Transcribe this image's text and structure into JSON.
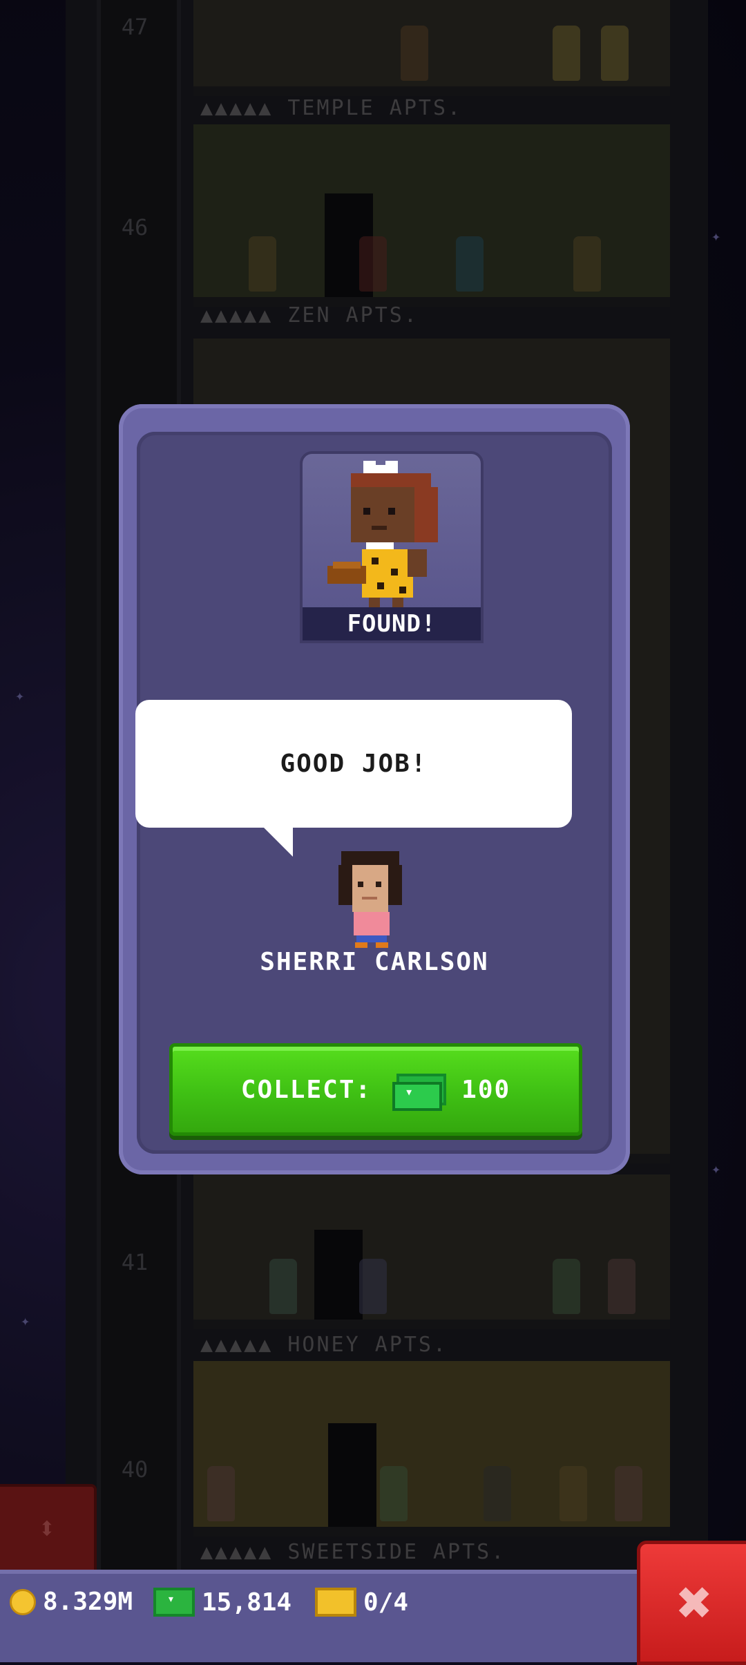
{
  "tower": {
    "floors": [
      {
        "number": "47",
        "name": ""
      },
      {
        "number": "46",
        "name": "TEMPLE APTS."
      },
      {
        "number": "",
        "name": "ZEN APTS."
      },
      {
        "number": "41",
        "name": ""
      },
      {
        "number": "40",
        "name": "HONEY APTS."
      },
      {
        "number": "",
        "name": "SWEETSIDE APTS."
      }
    ]
  },
  "modal": {
    "portrait_label": "FOUND!",
    "speech": "GOOD JOB!",
    "npc_name": "SHERRI CARLSON",
    "collect_label": "COLLECT:",
    "collect_amount": "100"
  },
  "bottom_bar": {
    "coins": "8.329M",
    "bux": "15,814",
    "tickets": "0/4"
  },
  "icons": {
    "coin": "coin-icon",
    "bux": "bux-icon",
    "ticket": "ticket-icon",
    "close": "close-icon",
    "elevator": "elevator-icon"
  },
  "colors": {
    "modal_bg": "#4c4878",
    "collect_green": "#3fc014",
    "close_red": "#e33131"
  }
}
